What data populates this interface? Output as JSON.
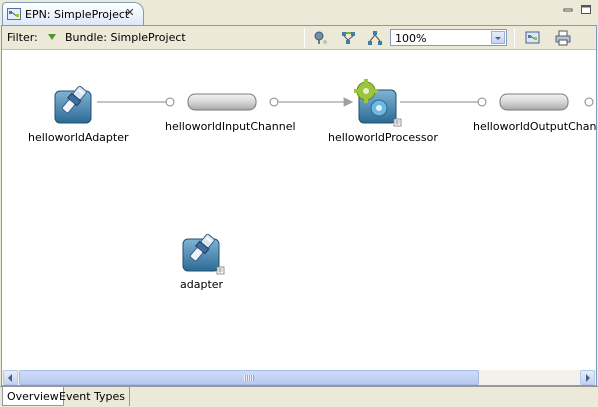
{
  "editor_tab": {
    "title": "EPN: SimpleProject"
  },
  "filter": {
    "label": "Filter:",
    "value": "Bundle: SimpleProject"
  },
  "zoom": {
    "value": "100%"
  },
  "nodes": {
    "adapter1": "helloworldAdapter",
    "input_channel": "helloworldInputChannel",
    "processor": "helloworldProcessor",
    "output_channel": "helloworldOutputChannel",
    "adapter2": "adapter"
  },
  "bottom_tabs": [
    "Overview",
    "Event Types"
  ],
  "colors": {
    "panel_bg": "#ece9d8",
    "canvas_bg": "#ffffff",
    "border": "#7f9db9",
    "connector": "#a0a0a0",
    "channel_fill": "#d8d8d8",
    "processor_gear": "#9bc53d",
    "adapter_tile": "#3d7fa8"
  },
  "icons": {
    "tab": "epn-editor-icon",
    "close": "close-icon",
    "minimize": "minimize-icon",
    "maximize": "maximize-icon",
    "toolbar": [
      "show-all-icon",
      "auto-layout-icon",
      "arrange-icon",
      "export-image-icon",
      "print-icon"
    ]
  }
}
